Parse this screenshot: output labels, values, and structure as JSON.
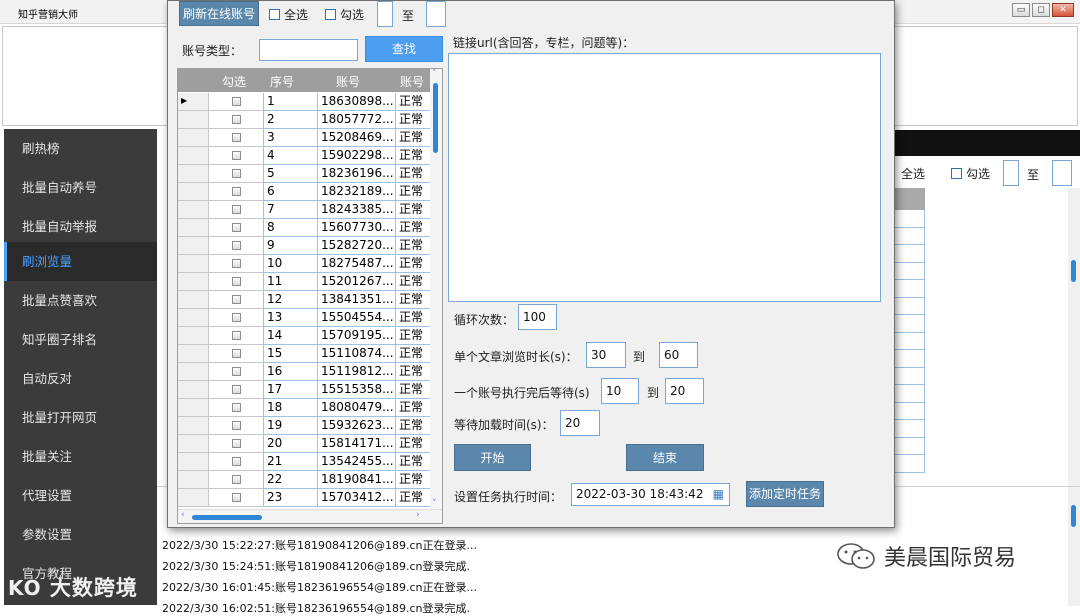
{
  "app": {
    "title": "知乎营销大师"
  },
  "sidebar": {
    "items": [
      {
        "label": "刷热榜"
      },
      {
        "label": "批量自动养号"
      },
      {
        "label": "批量自动举报"
      },
      {
        "label": "刷浏览量",
        "active": true
      },
      {
        "label": "批量点赞喜欢"
      },
      {
        "label": "知乎圈子排名"
      },
      {
        "label": "自动反对"
      },
      {
        "label": "批量打开网页"
      },
      {
        "label": "批量关注"
      },
      {
        "label": "代理设置"
      },
      {
        "label": "参数设置"
      },
      {
        "label": "官方教程"
      }
    ]
  },
  "background_toolbar": {
    "select_all": "全选",
    "check": "勾选",
    "to": "至"
  },
  "dialog": {
    "refresh_button": "刷新在线账号",
    "select_all": "全选",
    "check": "勾选",
    "to": "至",
    "account_type_label": "账号类型：",
    "find_button": "查找",
    "table": {
      "headers": [
        "勾选",
        "序号",
        "账号",
        "账号"
      ],
      "rows": [
        {
          "n": "1",
          "account": "18630898...",
          "status": "正常"
        },
        {
          "n": "2",
          "account": "18057772...",
          "status": "正常"
        },
        {
          "n": "3",
          "account": "15208469...",
          "status": "正常"
        },
        {
          "n": "4",
          "account": "15902298...",
          "status": "正常"
        },
        {
          "n": "5",
          "account": "18236196...",
          "status": "正常"
        },
        {
          "n": "6",
          "account": "18232189...",
          "status": "正常"
        },
        {
          "n": "7",
          "account": "18243385...",
          "status": "正常"
        },
        {
          "n": "8",
          "account": "15607730...",
          "status": "正常"
        },
        {
          "n": "9",
          "account": "15282720...",
          "status": "正常"
        },
        {
          "n": "10",
          "account": "18275487...",
          "status": "正常"
        },
        {
          "n": "11",
          "account": "15201267...",
          "status": "正常"
        },
        {
          "n": "12",
          "account": "13841351...",
          "status": "正常"
        },
        {
          "n": "13",
          "account": "15504554...",
          "status": "正常"
        },
        {
          "n": "14",
          "account": "15709195...",
          "status": "正常"
        },
        {
          "n": "15",
          "account": "15110874...",
          "status": "正常"
        },
        {
          "n": "16",
          "account": "15119812...",
          "status": "正常"
        },
        {
          "n": "17",
          "account": "15515358...",
          "status": "正常"
        },
        {
          "n": "18",
          "account": "18080479...",
          "status": "正常"
        },
        {
          "n": "19",
          "account": "15932623...",
          "status": "正常"
        },
        {
          "n": "20",
          "account": "15814171...",
          "status": "正常"
        },
        {
          "n": "21",
          "account": "13542455...",
          "status": "正常"
        },
        {
          "n": "22",
          "account": "18190841...",
          "status": "正常"
        },
        {
          "n": "23",
          "account": "15703412...",
          "status": "正常"
        }
      ]
    },
    "url_label": "链接url(含回答，专栏，问题等)：",
    "url_value": "",
    "loop_label": "循环次数：",
    "loop_value": "100",
    "browse_label": "单个文章浏览时长(s)：",
    "browse_from": "30",
    "browse_to_label": "到",
    "browse_to": "60",
    "wait_label": "一个账号执行完后等待(s)",
    "wait_from": "10",
    "wait_to_label": "到",
    "wait_to": "20",
    "load_label": "等待加载时间(s)：",
    "load_value": "20",
    "start_button": "开始",
    "end_button": "结束",
    "schedule_label": "设置任务执行时间：",
    "schedule_value": "2022-03-30 18:43:42",
    "add_task_button": "添加定时任务"
  },
  "log": {
    "lines": [
      "2022/3/30 15:22:27:账号18190841206@189.cn正在登录...",
      "2022/3/30 15:24:51:账号18190841206@189.cn登录完成.",
      "2022/3/30 16:01:45:账号18236196554@189.cn正在登录...",
      "2022/3/30 16:02:51:账号18236196554@189.cn登录完成."
    ]
  },
  "watermarks": {
    "left": "大数跨境",
    "right": "美晨国际贸易"
  }
}
